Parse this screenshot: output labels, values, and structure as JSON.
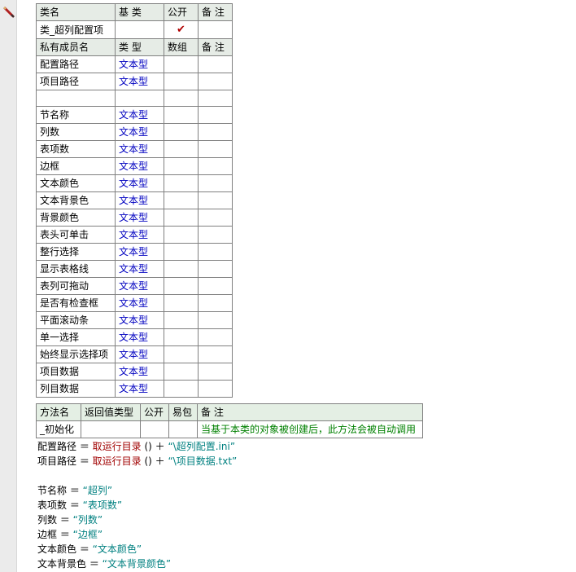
{
  "class_table": {
    "headers": [
      "类名",
      "基 类",
      "公开",
      "备 注"
    ],
    "class_name": "类_超列配置项",
    "base_class": "",
    "public_checked": true,
    "public_mark": "✔",
    "note": ""
  },
  "members_table": {
    "headers": [
      "私有成员名",
      "类 型",
      "数组",
      "备 注"
    ],
    "rows": [
      {
        "name": "配置路径",
        "type": "文本型"
      },
      {
        "name": "项目路径",
        "type": "文本型"
      },
      {
        "name": "",
        "type": ""
      },
      {
        "name": "节名称",
        "type": "文本型"
      },
      {
        "name": "列数",
        "type": "文本型"
      },
      {
        "name": "表项数",
        "type": "文本型"
      },
      {
        "name": "边框",
        "type": "文本型"
      },
      {
        "name": "文本颜色",
        "type": "文本型"
      },
      {
        "name": "文本背景色",
        "type": "文本型"
      },
      {
        "name": "背景颜色",
        "type": "文本型"
      },
      {
        "name": "表头可单击",
        "type": "文本型"
      },
      {
        "name": "整行选择",
        "type": "文本型"
      },
      {
        "name": "显示表格线",
        "type": "文本型"
      },
      {
        "name": "表列可拖动",
        "type": "文本型"
      },
      {
        "name": "是否有检查框",
        "type": "文本型"
      },
      {
        "name": "平面滚动条",
        "type": "文本型"
      },
      {
        "name": "单一选择",
        "type": "文本型"
      },
      {
        "name": "始终显示选择项",
        "type": "文本型"
      },
      {
        "name": "项目数据",
        "type": "文本型"
      },
      {
        "name": "列目数据",
        "type": "文本型"
      }
    ]
  },
  "methods_table": {
    "headers": [
      "方法名",
      "返回值类型",
      "公开",
      "易包",
      "备 注"
    ],
    "rows": [
      {
        "name": "_初始化",
        "return_type": "",
        "public": "",
        "easy_pkg": "",
        "note": "当基于本类的对象被创建后，此方法会被自动调用"
      }
    ]
  },
  "code_lines": [
    [
      {
        "t": "配置路径 ＝ ",
        "c": ""
      },
      {
        "t": "取运行目录",
        "c": "fn"
      },
      {
        "t": " () ＋ ",
        "c": ""
      },
      {
        "t": "“\\超列配置.ini”",
        "c": "str"
      }
    ],
    [
      {
        "t": "项目路径 ＝ ",
        "c": ""
      },
      {
        "t": "取运行目录",
        "c": "fn"
      },
      {
        "t": " () ＋ ",
        "c": ""
      },
      {
        "t": "“\\项目数据.txt”",
        "c": "str"
      }
    ],
    [],
    [
      {
        "t": "节名称 ＝ ",
        "c": ""
      },
      {
        "t": "“超列”",
        "c": "str"
      }
    ],
    [
      {
        "t": "表项数 ＝ ",
        "c": ""
      },
      {
        "t": "“表项数”",
        "c": "str"
      }
    ],
    [
      {
        "t": "列数 ＝ ",
        "c": ""
      },
      {
        "t": "“列数”",
        "c": "str"
      }
    ],
    [
      {
        "t": "边框 ＝ ",
        "c": ""
      },
      {
        "t": "“边框”",
        "c": "str"
      }
    ],
    [
      {
        "t": "文本颜色 ＝ ",
        "c": ""
      },
      {
        "t": "“文本颜色”",
        "c": "str"
      }
    ],
    [
      {
        "t": "文本背景色 ＝ ",
        "c": ""
      },
      {
        "t": "“文本背景颜色”",
        "c": "str"
      }
    ]
  ]
}
